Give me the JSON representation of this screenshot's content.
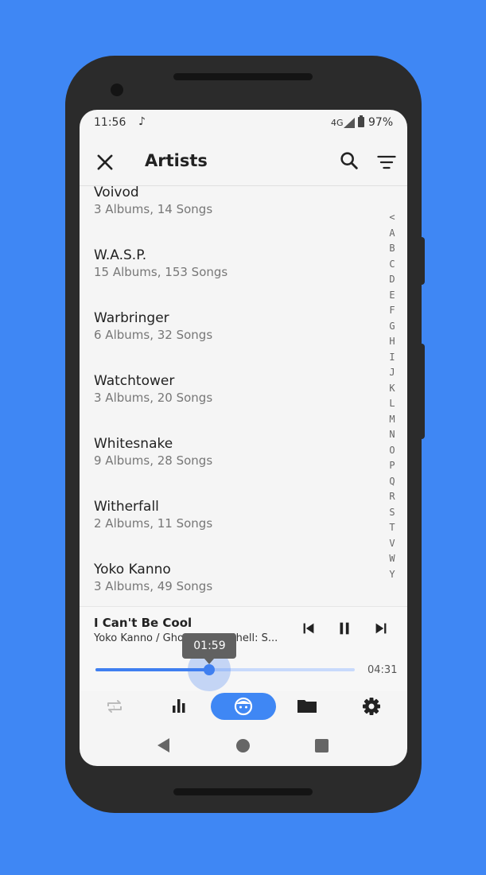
{
  "status": {
    "time": "11:56",
    "note_icon": "♪",
    "network": "4G",
    "battery": "97%"
  },
  "appbar": {
    "title": "Artists"
  },
  "artists": [
    {
      "name": "Voivod",
      "sub": "3 Albums, 14 Songs"
    },
    {
      "name": "W.A.S.P.",
      "sub": "15 Albums, 153 Songs"
    },
    {
      "name": "Warbringer",
      "sub": "6 Albums, 32 Songs"
    },
    {
      "name": "Watchtower",
      "sub": "3 Albums, 20 Songs"
    },
    {
      "name": "Whitesnake",
      "sub": "9 Albums, 28 Songs"
    },
    {
      "name": "Witherfall",
      "sub": "2 Albums, 11 Songs"
    },
    {
      "name": "Yoko Kanno",
      "sub": "3 Albums, 49 Songs"
    }
  ],
  "alphabet": [
    "<",
    "A",
    "B",
    "C",
    "D",
    "E",
    "F",
    "G",
    "H",
    "I",
    "J",
    "K",
    "L",
    "M",
    "N",
    "O",
    "P",
    "Q",
    "R",
    "S",
    "T",
    "V",
    "W",
    "Y"
  ],
  "player": {
    "title": "I Can't Be Cool",
    "subtitle": "Yoko Kanno / Ghost in the Shell: S...",
    "current_time": "01:59",
    "total_time": "04:31",
    "progress": 0.44
  },
  "colors": {
    "accent": "#3f87f4",
    "background": "#3f87f4"
  },
  "icons": {
    "close": "close-icon",
    "search": "search-icon",
    "sort": "sort-icon",
    "prev": "skip-previous-icon",
    "pause": "pause-icon",
    "next": "skip-next-icon",
    "repeat": "repeat-one-icon",
    "equalizer": "equalizer-icon",
    "artist": "artist-face-icon",
    "folder": "folder-icon",
    "settings": "settings-icon"
  }
}
